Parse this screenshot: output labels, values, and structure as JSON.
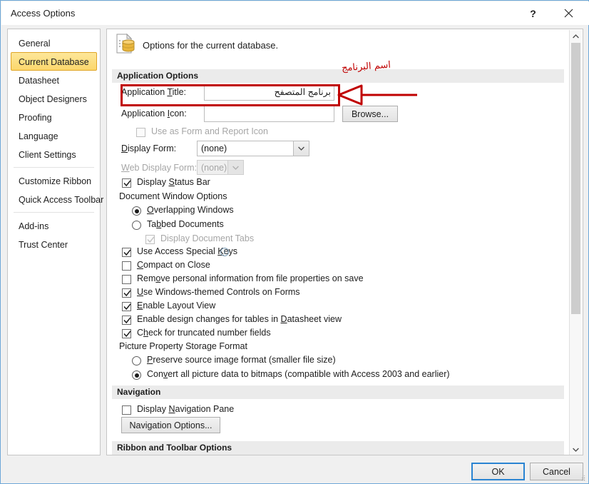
{
  "window": {
    "title": "Access Options",
    "help_button": "?",
    "close_button": "✕"
  },
  "sidebar": {
    "items": [
      {
        "label": "General",
        "selected": false
      },
      {
        "label": "Current Database",
        "selected": true
      },
      {
        "label": "Datasheet",
        "selected": false
      },
      {
        "label": "Object Designers",
        "selected": false
      },
      {
        "label": "Proofing",
        "selected": false
      },
      {
        "label": "Language",
        "selected": false
      },
      {
        "label": "Client Settings",
        "selected": false
      },
      {
        "label": "Customize Ribbon",
        "selected": false
      },
      {
        "label": "Quick Access Toolbar",
        "selected": false
      },
      {
        "label": "Add-ins",
        "selected": false
      },
      {
        "label": "Trust Center",
        "selected": false
      }
    ]
  },
  "pane": {
    "heading": "Options for the current database.",
    "sections": {
      "application_options": "Application Options",
      "navigation": "Navigation",
      "ribbon_and_toolbar": "Ribbon and Toolbar Options"
    },
    "application_title": {
      "label_pre": "Application ",
      "label_accel": "T",
      "label_post": "itle:",
      "value": "برنامج المتصفح"
    },
    "application_icon": {
      "label_pre": "Application ",
      "label_accel": "I",
      "label_post": "con:",
      "value": "",
      "browse_label": "Browse..."
    },
    "use_as_form_icon": {
      "label": "Use as Form and Report Icon",
      "checked": false,
      "disabled": true
    },
    "display_form": {
      "label_accel": "D",
      "label_post": "isplay Form:",
      "value": "(none)",
      "disabled": false
    },
    "web_display_form": {
      "label_accel": "W",
      "label_post": "eb Display Form:",
      "value": "(none)",
      "disabled": true
    },
    "display_status_bar": {
      "pre": "Display ",
      "accel": "S",
      "post": "tatus Bar",
      "checked": true
    },
    "document_window_options": {
      "label": "Document Window Options",
      "overlapping": {
        "pre": "",
        "accel": "O",
        "post": "verlapping Windows",
        "selected": true
      },
      "tabbed": {
        "pre": "Ta",
        "accel": "b",
        "post": "bed Documents",
        "selected": false
      },
      "display_document_tabs": {
        "label": "Display Document Tabs",
        "checked": true,
        "disabled": true
      }
    },
    "checkboxes": [
      {
        "pre": "Use Access Special ",
        "accel": "K",
        "post": "eys",
        "checked": true,
        "info": true
      },
      {
        "pre": "",
        "accel": "C",
        "post": "ompact on Close",
        "checked": false,
        "info": false
      },
      {
        "pre": "Rem",
        "accel": "o",
        "post": "ve personal information from file properties on save",
        "checked": false,
        "info": false
      },
      {
        "pre": "",
        "accel": "U",
        "post": "se Windows-themed Controls on Forms",
        "checked": true,
        "info": false
      },
      {
        "pre": "",
        "accel": "E",
        "post": "nable Layout View",
        "checked": true,
        "info": false
      },
      {
        "pre": "Enable design changes for tables in ",
        "accel": "D",
        "post": "atasheet view",
        "checked": true,
        "info": false
      },
      {
        "pre": "C",
        "accel": "h",
        "post": "eck for truncated number fields",
        "checked": true,
        "info": false
      }
    ],
    "picture_property": {
      "label": "Picture Property Storage Format",
      "preserve": {
        "pre": "",
        "accel": "P",
        "post": "reserve source image format (smaller file size)",
        "selected": false
      },
      "convert": {
        "pre": "Con",
        "accel": "v",
        "post": "ert all picture data to bitmaps (compatible with Access 2003 and earlier)",
        "selected": true
      }
    },
    "navigation": {
      "display_nav_pane": {
        "pre": "Display ",
        "accel": "N",
        "post": "avigation Pane",
        "checked": false
      },
      "nav_options_button": "Navigation Options..."
    }
  },
  "footer": {
    "ok": "OK",
    "cancel": "Cancel"
  },
  "annotations": {
    "title_note": "اسم البرنامج",
    "color": "#c00000"
  }
}
